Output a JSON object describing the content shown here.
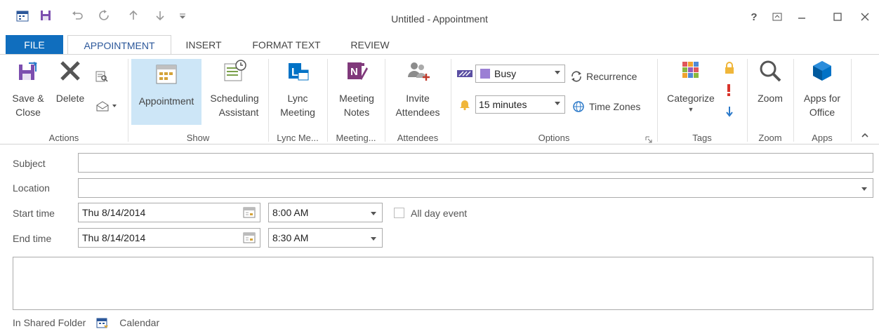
{
  "window": {
    "title": "Untitled - Appointment",
    "help_label": "?",
    "accent": "#106ebe"
  },
  "tabs": [
    {
      "label": "FILE"
    },
    {
      "label": "APPOINTMENT"
    },
    {
      "label": "INSERT"
    },
    {
      "label": "FORMAT TEXT"
    },
    {
      "label": "REVIEW"
    }
  ],
  "ribbon": {
    "actions": {
      "label": "Actions",
      "save_close": [
        "Save &",
        "Close"
      ],
      "delete": "Delete"
    },
    "show": {
      "label": "Show",
      "appointment": "Appointment",
      "scheduling": [
        "Scheduling",
        "Assistant"
      ]
    },
    "lync": {
      "label": "Lync Me...",
      "lync_meeting": [
        "Lync",
        "Meeting"
      ]
    },
    "meeting_notes": {
      "label": "Meeting...",
      "notes": [
        "Meeting",
        "Notes"
      ]
    },
    "attendees": {
      "label": "Attendees",
      "invite": [
        "Invite",
        "Attendees"
      ]
    },
    "options": {
      "label": "Options",
      "show_as": "Busy",
      "reminder": "15 minutes",
      "recurrence": "Recurrence",
      "time_zones": "Time Zones"
    },
    "tags": {
      "label": "Tags",
      "categorize": "Categorize"
    },
    "zoom": {
      "label": "Zoom",
      "zoom": "Zoom"
    },
    "apps": {
      "label": "Apps",
      "apps_office": [
        "Apps for",
        "Office"
      ]
    }
  },
  "form": {
    "subject_label": "Subject",
    "subject_value": "",
    "location_label": "Location",
    "location_value": "",
    "start_label": "Start time",
    "start_date": "Thu 8/14/2014",
    "start_time": "8:00 AM",
    "end_label": "End time",
    "end_date": "Thu 8/14/2014",
    "end_time": "8:30 AM",
    "all_day_label": "All day event",
    "all_day_checked": false
  },
  "footer": {
    "shared_label": "In Shared Folder",
    "folder": "Calendar"
  }
}
